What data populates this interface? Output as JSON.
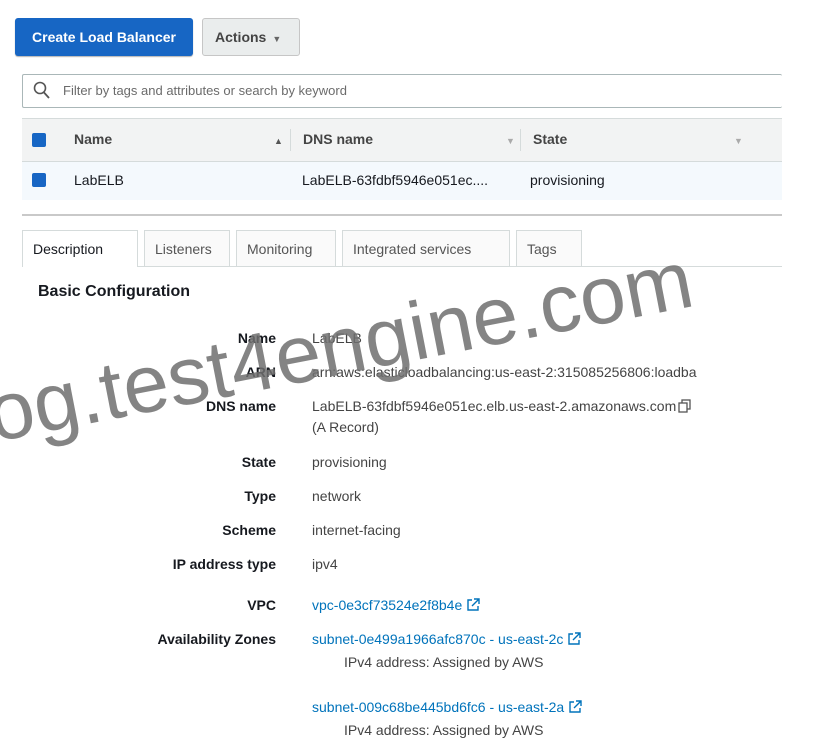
{
  "toolbar": {
    "create_label": "Create Load Balancer",
    "actions_label": "Actions"
  },
  "search": {
    "placeholder": "Filter by tags and attributes or search by keyword"
  },
  "table": {
    "columns": [
      "Name",
      "DNS name",
      "State"
    ],
    "rows": [
      {
        "name": "LabELB",
        "dns": "LabELB-63fdbf5946e051ec....",
        "state": "provisioning"
      }
    ]
  },
  "tabs": [
    "Description",
    "Listeners",
    "Monitoring",
    "Integrated services",
    "Tags"
  ],
  "details": {
    "section_title": "Basic Configuration",
    "name": {
      "label": "Name",
      "value": "LabELB"
    },
    "arn": {
      "label": "ARN",
      "value": "arn:aws:elasticloadbalancing:us-east-2:315085256806:loadba"
    },
    "dns": {
      "label": "DNS name",
      "value": "LabELB-63fdbf5946e051ec.elb.us-east-2.amazonaws.com",
      "value2": "(A Record)"
    },
    "state": {
      "label": "State",
      "value": "provisioning"
    },
    "type": {
      "label": "Type",
      "value": "network"
    },
    "scheme": {
      "label": "Scheme",
      "value": "internet-facing"
    },
    "ip_type": {
      "label": "IP address type",
      "value": "ipv4"
    },
    "vpc": {
      "label": "VPC",
      "value": "vpc-0e3cf73524e2f8b4e"
    },
    "az": {
      "label": "Availability Zones",
      "items": [
        {
          "subnet": "subnet-0e499a1966afc870c - us-east-2c",
          "ip": "IPv4 address: Assigned by AWS"
        },
        {
          "subnet": "subnet-009c68be445bd6fc6 - us-east-2a",
          "ip": "IPv4 address: Assigned by AWS"
        }
      ]
    }
  },
  "watermark": "og.test4engine.com",
  "colors": {
    "primary": "#1766c4",
    "link": "#0073bb",
    "watermark": "#6f6f6f"
  }
}
